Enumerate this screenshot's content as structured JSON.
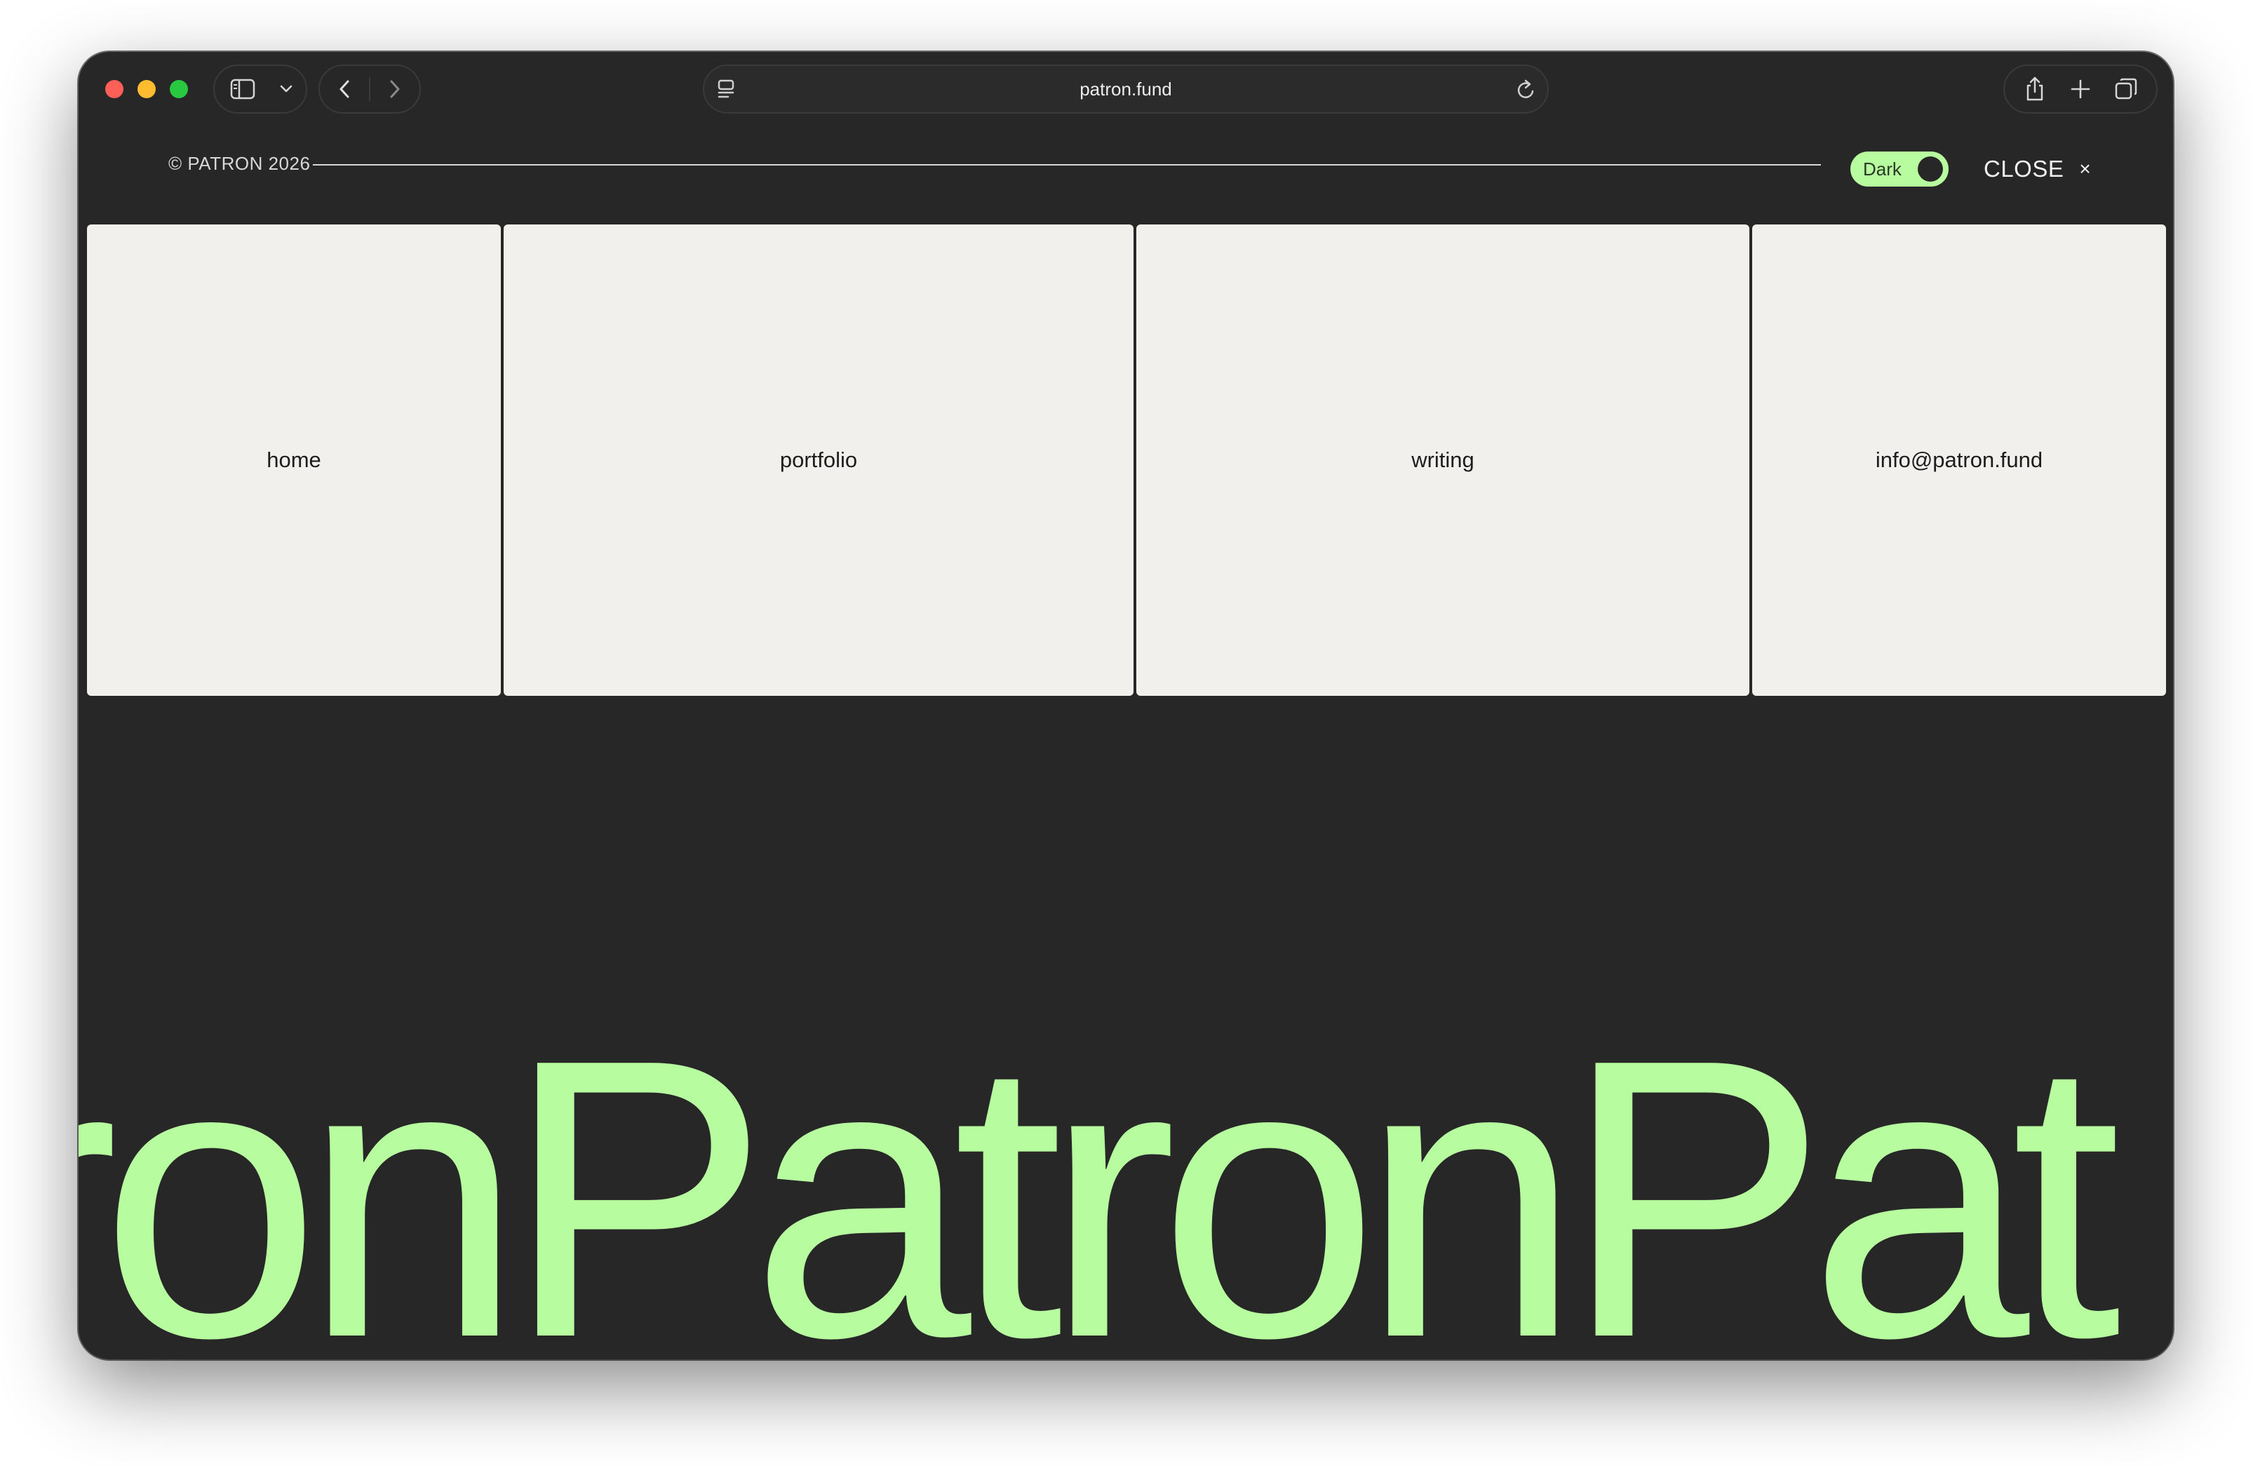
{
  "browser": {
    "url": "patron.fund"
  },
  "header": {
    "copyright": "© PATRON 2026",
    "theme_toggle_label": "Dark",
    "close_label": "CLOSE",
    "close_glyph": "×"
  },
  "nav_cards": [
    {
      "label": "home"
    },
    {
      "label": "portfolio"
    },
    {
      "label": "writing"
    },
    {
      "label": "info@patron.fund"
    }
  ],
  "marquee": {
    "text": "tronPatronPat"
  },
  "colors": {
    "page_background": "#272727",
    "accent_green": "#b8fca0",
    "card_background": "#f2f0ec"
  },
  "icons": {
    "sidebar": "sidebar-icon",
    "tab_menu": "chevron-down-icon",
    "back": "chevron-left-icon",
    "forward": "chevron-right-icon",
    "page_menu": "page-menu-icon",
    "reload": "reload-icon",
    "share": "share-icon",
    "new_tab": "plus-icon",
    "tabs_overview": "tabs-icon"
  }
}
